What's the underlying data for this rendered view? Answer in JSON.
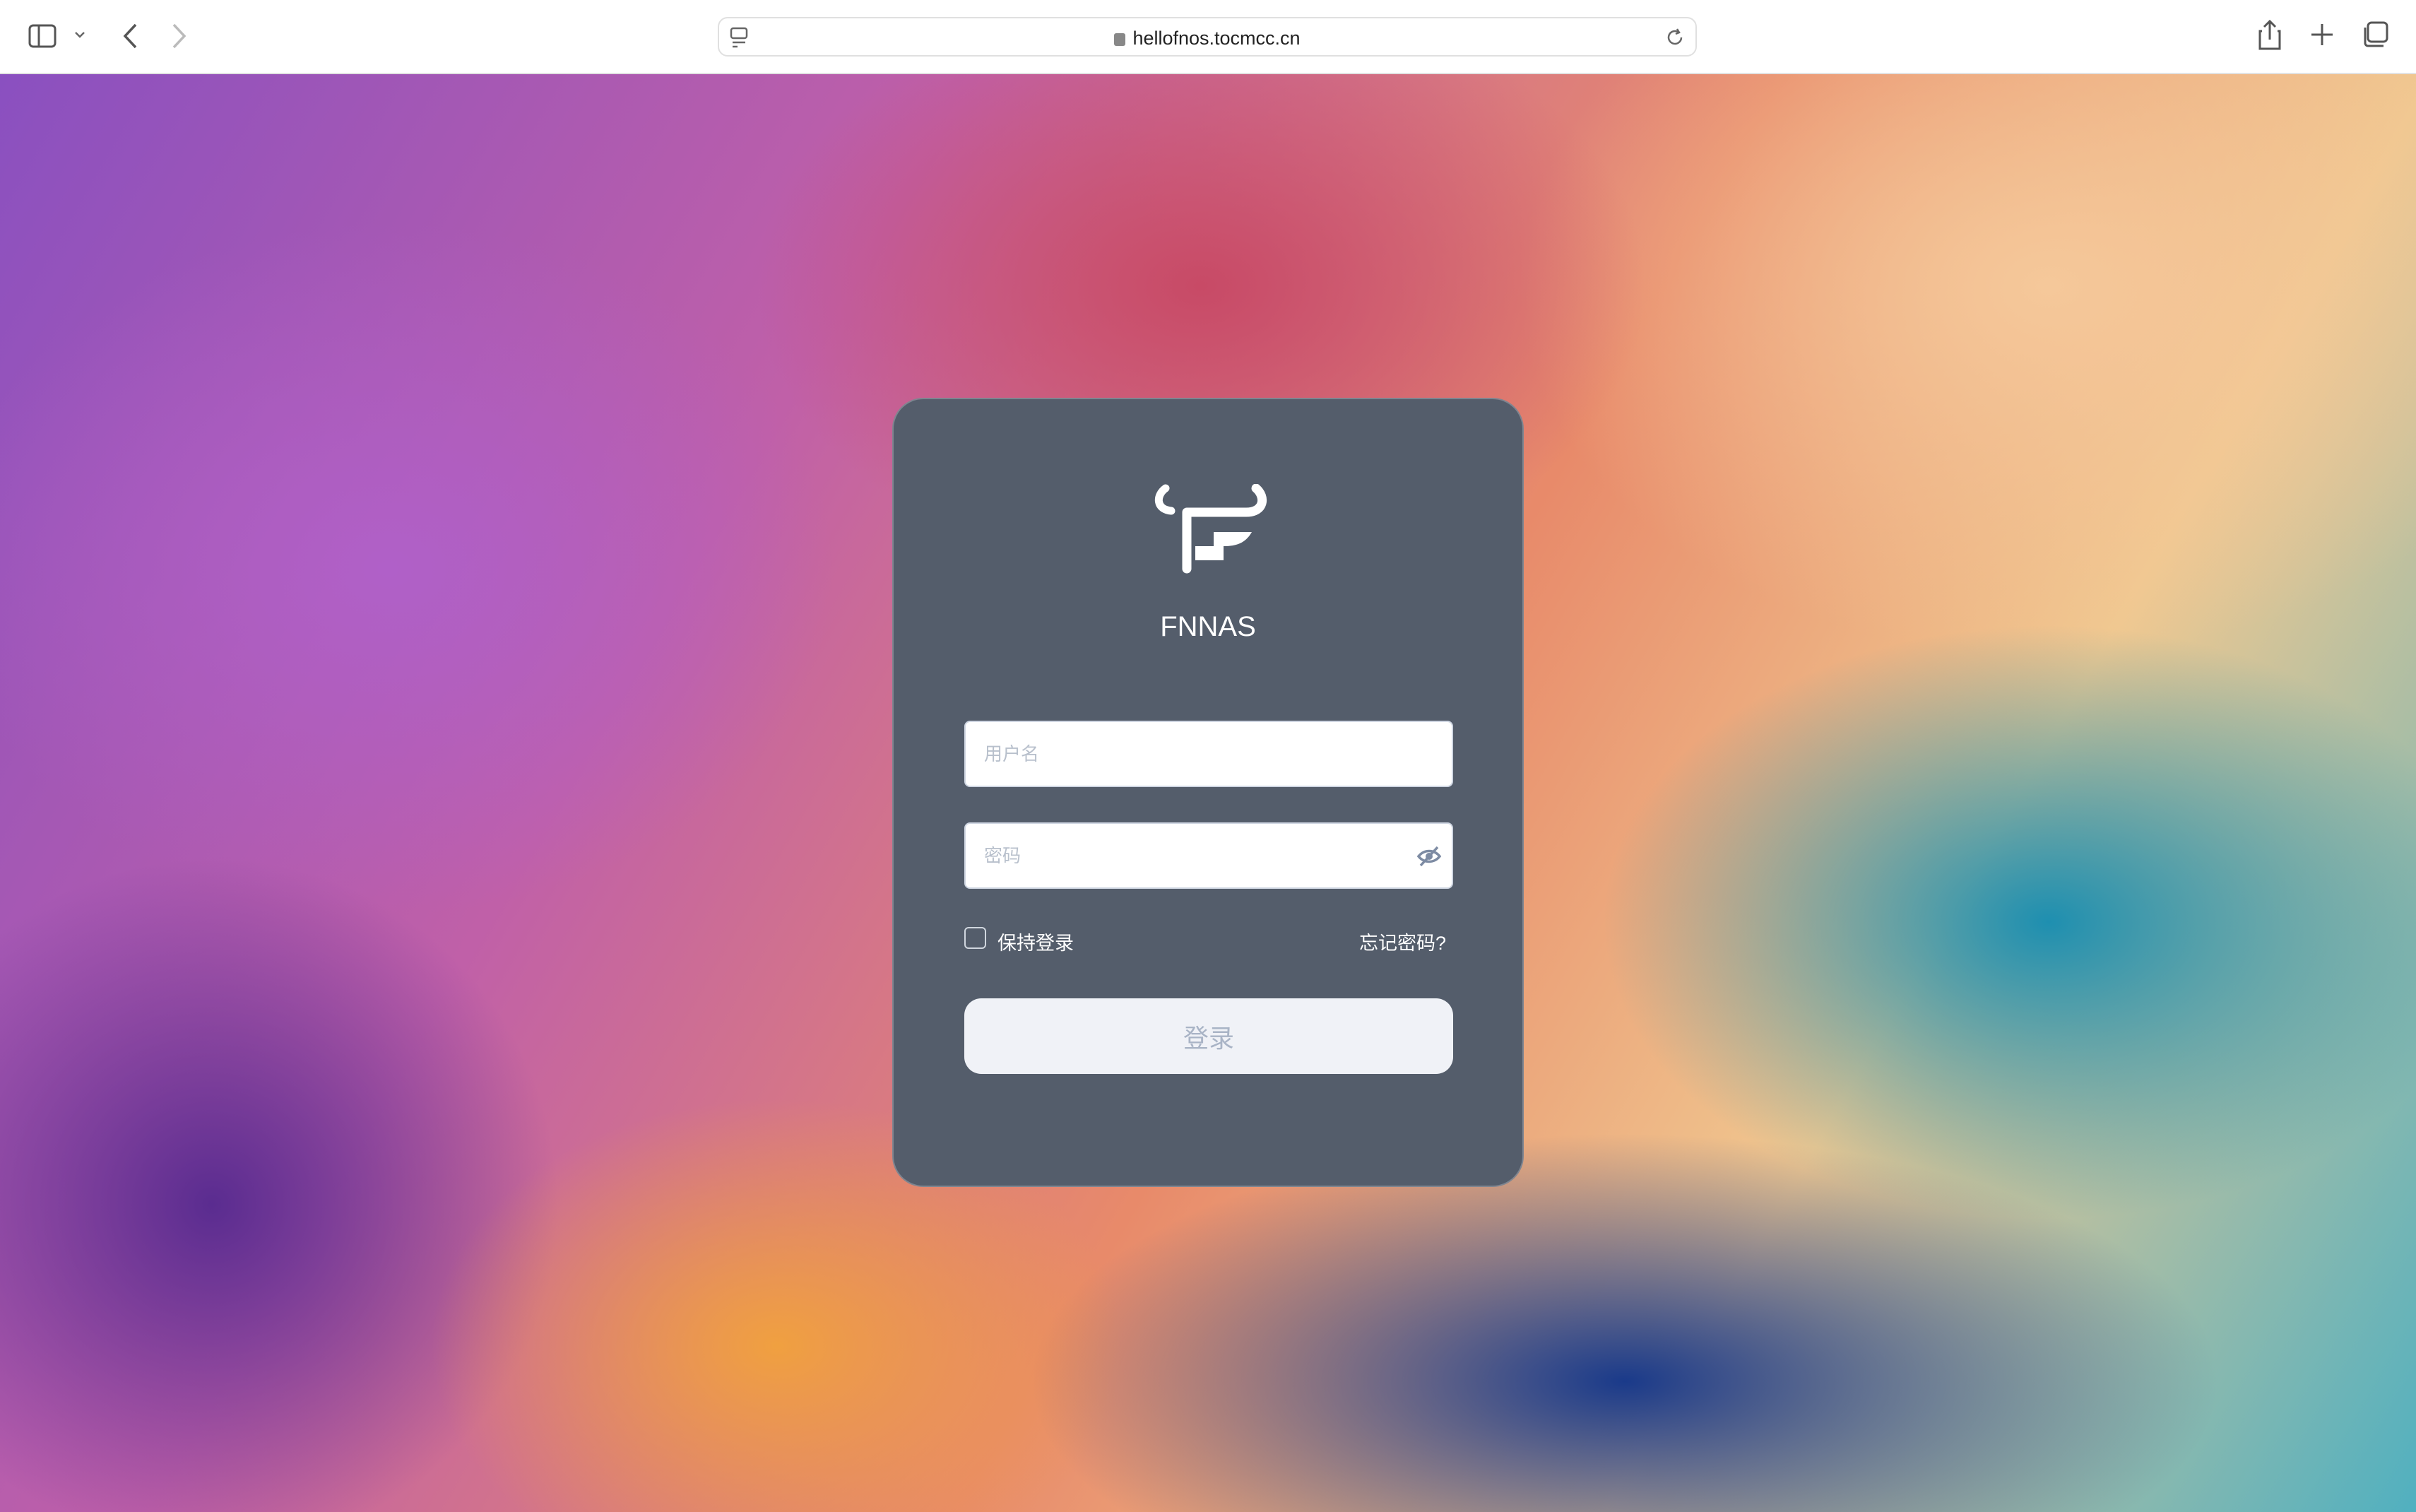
{
  "browser": {
    "url": "hellofnos.tocmcc.cn"
  },
  "login": {
    "brand": "FNNAS",
    "username_placeholder": "用户名",
    "password_placeholder": "密码",
    "remember_label": "保持登录",
    "remember_checked": false,
    "forgot_label": "忘记密码?",
    "submit_label": "登录"
  },
  "colors": {
    "card": "#545d6b",
    "button": "#f0f2f7",
    "button_text": "#a9b4c6"
  }
}
